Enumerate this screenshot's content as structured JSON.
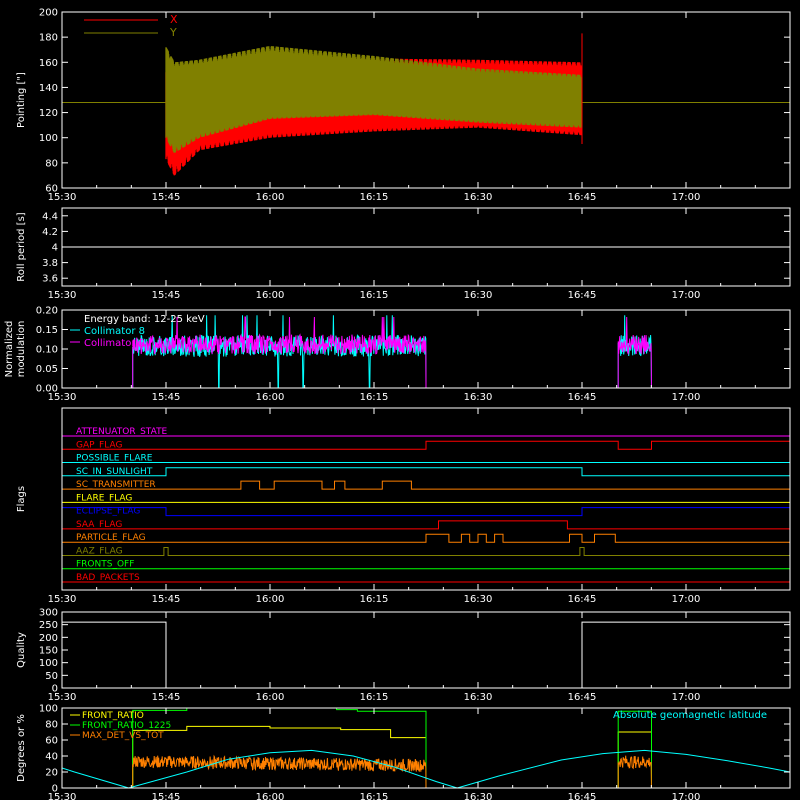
{
  "chart_data": [
    {
      "id": "pointing",
      "type": "line",
      "ylabel": "Pointing [\"]",
      "ylim": [
        60,
        200
      ],
      "yticks": [
        60,
        80,
        100,
        120,
        140,
        160,
        180,
        200
      ],
      "x_tick_labels": [
        "15:30",
        "15:45",
        "16:00",
        "16:15",
        "16:30",
        "16:45",
        "17:00"
      ],
      "legend_position": "top-left",
      "series": [
        {
          "name": "X",
          "color": "#ff0000",
          "center": 128,
          "upper": [
            [
              15.75,
              152
            ],
            [
              15.77,
              148
            ],
            [
              15.83,
              155
            ],
            [
              16.0,
              160
            ],
            [
              16.25,
              163
            ],
            [
              16.5,
              162
            ],
            [
              16.75,
              160
            ]
          ],
          "lower": [
            [
              15.75,
              83
            ],
            [
              15.77,
              70
            ],
            [
              15.83,
              90
            ],
            [
              16.0,
              100
            ],
            [
              16.25,
              105
            ],
            [
              16.5,
              108
            ],
            [
              16.75,
              102
            ]
          ]
        },
        {
          "name": "Y",
          "color": "#808000",
          "center": 128,
          "upper": [
            [
              15.75,
              172
            ],
            [
              15.77,
              160
            ],
            [
              15.83,
              162
            ],
            [
              16.0,
              173
            ],
            [
              16.25,
              165
            ],
            [
              16.5,
              155
            ],
            [
              16.75,
              150
            ]
          ],
          "lower": [
            [
              15.75,
              100
            ],
            [
              15.77,
              88
            ],
            [
              15.83,
              100
            ],
            [
              16.0,
              115
            ],
            [
              16.25,
              118
            ],
            [
              16.5,
              112
            ],
            [
              16.75,
              108
            ]
          ]
        }
      ],
      "spikes": [
        {
          "x": 16.75,
          "y": 183,
          "color": "#ff0000"
        }
      ]
    },
    {
      "id": "roll_period",
      "type": "line",
      "ylabel": "Roll period [s]",
      "ylim": [
        3.5,
        4.5
      ],
      "yticks": [
        3.6,
        3.8,
        4.0,
        4.2,
        4.4
      ],
      "x_tick_labels": [
        "15:30",
        "15:45",
        "16:00",
        "16:15",
        "16:30",
        "16:45",
        "17:00"
      ],
      "series": [
        {
          "name": "",
          "color": "#ffffff",
          "points": [
            [
              15.5,
              4.0
            ],
            [
              17.25,
              4.0
            ]
          ]
        }
      ]
    },
    {
      "id": "modulation",
      "type": "line",
      "ylabel": "Normalized modulation",
      "ylim": [
        0,
        0.2
      ],
      "yticks": [
        "0.00",
        "0.05",
        "0.10",
        "0.15",
        "0.20"
      ],
      "x_tick_labels": [
        "15:30",
        "15:45",
        "16:00",
        "16:15",
        "16:30",
        "16:45",
        "17:00"
      ],
      "annotation": "Energy band: 12-25 keV",
      "segments": [
        [
          15.67,
          16.375
        ],
        [
          16.837,
          16.917
        ]
      ],
      "series": [
        {
          "name": "Collimator 8",
          "color": "#00ffff",
          "mean": 0.108,
          "spread": 0.028
        },
        {
          "name": "Collimator 9",
          "color": "#ff00ff",
          "mean": 0.112,
          "spread": 0.025
        }
      ],
      "dropouts": [
        15.877,
        16.02,
        16.08,
        16.24
      ]
    },
    {
      "id": "flags",
      "type": "line",
      "ylabel": "Flags",
      "x_tick_labels": [
        "15:30",
        "15:45",
        "16:00",
        "16:15",
        "16:30",
        "16:45",
        "17:00"
      ],
      "flags": [
        {
          "name": "ATTENUATOR_STATE",
          "color": "#ff00ff",
          "steps": [
            [
              15.5,
              0
            ],
            [
              17.25,
              0
            ]
          ]
        },
        {
          "name": "GAP_FLAG",
          "color": "#ff0000",
          "steps": [
            [
              15.5,
              0
            ],
            [
              16.375,
              0
            ],
            [
              16.375,
              1
            ],
            [
              16.837,
              1
            ],
            [
              16.837,
              0
            ],
            [
              16.917,
              0
            ],
            [
              16.917,
              1
            ],
            [
              17.25,
              1
            ]
          ]
        },
        {
          "name": "POSSIBLE_FLARE",
          "color": "#00ffff",
          "steps": [
            [
              15.5,
              0
            ],
            [
              17.25,
              0
            ]
          ]
        },
        {
          "name": "SC_IN_SUNLIGHT",
          "color": "#00ffff",
          "steps": [
            [
              15.5,
              0
            ],
            [
              15.75,
              0
            ],
            [
              15.75,
              1
            ],
            [
              16.75,
              1
            ],
            [
              16.75,
              0
            ],
            [
              17.25,
              0
            ]
          ]
        },
        {
          "name": "SC_TRANSMITTER",
          "color": "#ff8000",
          "steps": [
            [
              15.5,
              0
            ],
            [
              15.93,
              0
            ],
            [
              15.93,
              1
            ],
            [
              15.975,
              1
            ],
            [
              15.975,
              0
            ],
            [
              16.01,
              0
            ],
            [
              16.01,
              1
            ],
            [
              16.125,
              1
            ],
            [
              16.125,
              0
            ],
            [
              16.155,
              0
            ],
            [
              16.155,
              1
            ],
            [
              16.18,
              1
            ],
            [
              16.18,
              0
            ],
            [
              16.27,
              0
            ],
            [
              16.27,
              1
            ],
            [
              16.34,
              1
            ],
            [
              16.34,
              0
            ],
            [
              17.25,
              0
            ]
          ]
        },
        {
          "name": "FLARE_FLAG",
          "color": "#ffff00",
          "steps": [
            [
              15.5,
              0
            ],
            [
              17.25,
              0
            ]
          ]
        },
        {
          "name": "ECLIPSE_FLAG",
          "color": "#0000ff",
          "steps": [
            [
              15.5,
              1
            ],
            [
              15.75,
              1
            ],
            [
              15.75,
              0
            ],
            [
              16.75,
              0
            ],
            [
              16.75,
              1
            ],
            [
              17.25,
              1
            ]
          ]
        },
        {
          "name": "SAA_FLAG",
          "color": "#ff0000",
          "steps": [
            [
              15.5,
              0
            ],
            [
              16.405,
              0
            ],
            [
              16.405,
              1
            ],
            [
              16.715,
              1
            ],
            [
              16.715,
              0
            ],
            [
              17.25,
              0
            ]
          ]
        },
        {
          "name": "PARTICLE_FLAG",
          "color": "#ff8000",
          "steps": [
            [
              15.5,
              0
            ],
            [
              16.375,
              0
            ],
            [
              16.375,
              1
            ],
            [
              16.43,
              1
            ],
            [
              16.43,
              0
            ],
            [
              16.46,
              0
            ],
            [
              16.46,
              1
            ],
            [
              16.48,
              1
            ],
            [
              16.48,
              0
            ],
            [
              16.5,
              0
            ],
            [
              16.5,
              1
            ],
            [
              16.52,
              1
            ],
            [
              16.52,
              0
            ],
            [
              16.54,
              0
            ],
            [
              16.54,
              1
            ],
            [
              16.56,
              1
            ],
            [
              16.56,
              0
            ],
            [
              16.72,
              0
            ],
            [
              16.72,
              1
            ],
            [
              16.75,
              1
            ],
            [
              16.75,
              0
            ],
            [
              16.78,
              0
            ],
            [
              16.78,
              1
            ],
            [
              16.83,
              1
            ],
            [
              16.83,
              0
            ],
            [
              17.25,
              0
            ]
          ]
        },
        {
          "name": "AAZ_FLAG",
          "color": "#808000",
          "steps": [
            [
              15.5,
              0
            ],
            [
              15.745,
              0
            ],
            [
              15.745,
              1
            ],
            [
              15.755,
              1
            ],
            [
              15.755,
              0
            ],
            [
              16.745,
              0
            ],
            [
              16.745,
              1
            ],
            [
              16.755,
              1
            ],
            [
              16.755,
              0
            ],
            [
              17.25,
              0
            ]
          ]
        },
        {
          "name": "FRONTS_OFF",
          "color": "#00ff00",
          "steps": [
            [
              15.5,
              0
            ],
            [
              17.25,
              0
            ]
          ]
        },
        {
          "name": "BAD_PACKETS",
          "color": "#ff0000",
          "steps": [
            [
              15.5,
              0
            ],
            [
              17.25,
              0
            ]
          ]
        }
      ]
    },
    {
      "id": "quality",
      "type": "line",
      "ylabel": "Quality",
      "ylim": [
        0,
        300
      ],
      "yticks": [
        0,
        50,
        100,
        150,
        200,
        250,
        300
      ],
      "x_tick_labels": [
        "15:30",
        "15:45",
        "16:00",
        "16:15",
        "16:30",
        "16:45",
        "17:00"
      ],
      "series": [
        {
          "name": "",
          "color": "#ffffff",
          "points": [
            [
              15.5,
              260
            ],
            [
              15.75,
              260
            ],
            [
              15.75,
              0
            ],
            [
              16.75,
              0
            ],
            [
              16.75,
              260
            ],
            [
              17.25,
              260
            ]
          ]
        }
      ]
    },
    {
      "id": "ratios",
      "type": "line",
      "ylabel": "Degrees or %",
      "ylim": [
        0,
        100
      ],
      "yticks": [
        0,
        20,
        40,
        60,
        80,
        100
      ],
      "x_tick_labels": [
        "15:30",
        "15:45",
        "16:00",
        "16:15",
        "16:30",
        "16:45",
        "17:00"
      ],
      "legend_position": "top-left",
      "right_label": "Absolute geomagnetic latitude",
      "series": [
        {
          "name": "FRONT_RATIO",
          "color": "#ffff00",
          "points": [
            [
              15.5,
              0
            ],
            [
              15.67,
              0
            ],
            [
              15.67,
              72
            ],
            [
              15.8,
              72
            ],
            [
              15.8,
              77
            ],
            [
              16.0,
              77
            ],
            [
              16.0,
              75
            ],
            [
              16.17,
              75
            ],
            [
              16.17,
              73
            ],
            [
              16.29,
              73
            ],
            [
              16.29,
              63
            ],
            [
              16.375,
              63
            ],
            [
              16.375,
              0
            ],
            [
              16.837,
              0
            ],
            [
              16.837,
              70
            ],
            [
              16.917,
              70
            ],
            [
              16.917,
              0
            ],
            [
              17.25,
              0
            ]
          ]
        },
        {
          "name": "FRONT_RATIO_1225",
          "color": "#00ff00",
          "points": [
            [
              15.5,
              0
            ],
            [
              15.67,
              0
            ],
            [
              15.67,
              97
            ],
            [
              15.8,
              97
            ],
            [
              15.8,
              100
            ],
            [
              16.16,
              100
            ],
            [
              16.16,
              98
            ],
            [
              16.21,
              98
            ],
            [
              16.21,
              96
            ],
            [
              16.375,
              96
            ],
            [
              16.375,
              0
            ],
            [
              16.837,
              0
            ],
            [
              16.837,
              96
            ],
            [
              16.917,
              96
            ],
            [
              16.917,
              0
            ],
            [
              17.25,
              0
            ]
          ]
        },
        {
          "name": "MAX_DET_VS_TOT",
          "color": "#ff8000",
          "segments": [
            [
              15.67,
              16.375
            ],
            [
              16.837,
              16.917
            ]
          ],
          "mean": 28,
          "spread": 8
        },
        {
          "name": "Absolute geomagnetic latitude",
          "color": "#00ffff",
          "points": [
            [
              15.5,
              25
            ],
            [
              15.53,
              20
            ],
            [
              15.66,
              0
            ],
            [
              15.8,
              20
            ],
            [
              15.9,
              36
            ],
            [
              16.0,
              44
            ],
            [
              16.1,
              47
            ],
            [
              16.2,
              40
            ],
            [
              16.3,
              26
            ],
            [
              16.4,
              8
            ],
            [
              16.45,
              0
            ],
            [
              16.55,
              15
            ],
            [
              16.7,
              35
            ],
            [
              16.8,
              43
            ],
            [
              16.9,
              47
            ],
            [
              17.0,
              42
            ],
            [
              17.1,
              34
            ],
            [
              17.2,
              25
            ],
            [
              17.25,
              20
            ]
          ]
        }
      ]
    }
  ]
}
